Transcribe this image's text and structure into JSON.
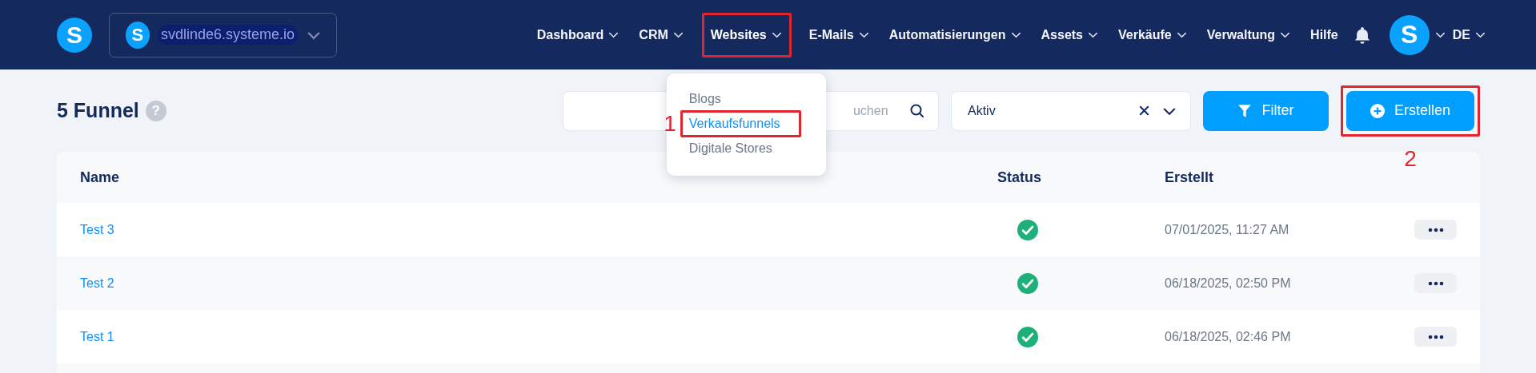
{
  "header": {
    "logo_letter": "S",
    "account": {
      "avatar_letter": "S",
      "domain": "svdlinde6.systeme.io"
    },
    "nav_items": [
      {
        "label": "Dashboard",
        "dropdown": true,
        "expanded": false
      },
      {
        "label": "CRM",
        "dropdown": true,
        "expanded": false
      },
      {
        "label": "Websites",
        "dropdown": true,
        "expanded": true,
        "highlighted": true,
        "menu": [
          {
            "label": "Blogs",
            "selected": false
          },
          {
            "label": "Verkaufsfunnels",
            "selected": true,
            "highlighted": true,
            "annotation": "1"
          },
          {
            "label": "Digitale Stores",
            "selected": false
          }
        ]
      },
      {
        "label": "E-Mails",
        "dropdown": true,
        "expanded": false
      },
      {
        "label": "Automatisierungen",
        "dropdown": true,
        "expanded": false
      },
      {
        "label": "Assets",
        "dropdown": true,
        "expanded": false
      },
      {
        "label": "Verkäufe",
        "dropdown": true,
        "expanded": false
      },
      {
        "label": "Verwaltung",
        "dropdown": true,
        "expanded": false
      },
      {
        "label": "Hilfe",
        "dropdown": false,
        "expanded": false
      }
    ],
    "user_avatar_letter": "S",
    "language": "DE"
  },
  "page": {
    "title": "5 Funnel",
    "help_icon": "?",
    "search": {
      "placeholder": "uchen"
    },
    "status_select": {
      "value": "Aktiv"
    },
    "buttons": [
      {
        "kind": "filter",
        "label": "Filter"
      },
      {
        "kind": "create",
        "label": "Erstellen",
        "highlighted": true,
        "annotation": "2"
      }
    ]
  },
  "table": {
    "columns": [
      "Name",
      "Status",
      "Erstellt"
    ],
    "rows": [
      {
        "name": "Test 3",
        "active": true,
        "created": "07/01/2025, 11:27 AM"
      },
      {
        "name": "Test 2",
        "active": true,
        "created": "06/18/2025, 02:50 PM"
      },
      {
        "name": "Test 1",
        "active": true,
        "created": "06/18/2025, 02:46 PM"
      }
    ]
  }
}
